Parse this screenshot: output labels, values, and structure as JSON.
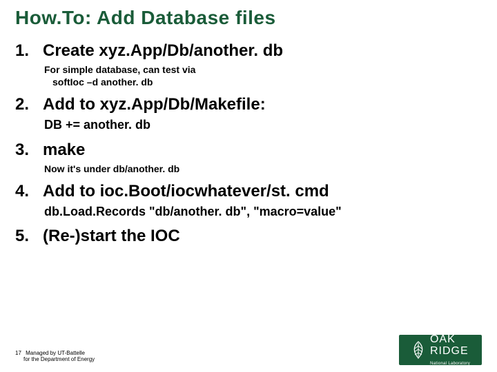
{
  "title": "How.To: Add Database files",
  "steps": [
    {
      "num": "1.",
      "head": "Create xyz.App/Db/another. db",
      "sub_line1": "For simple database, can test via",
      "sub_line2": "softIoc –d another. db"
    },
    {
      "num": "2.",
      "head": "Add to xyz.App/Db/Makefile:",
      "sub_line1": "DB += another. db",
      "sub_line2": ""
    },
    {
      "num": "3.",
      "head": "make",
      "sub_line1": "Now it's under db/another. db",
      "sub_line2": ""
    },
    {
      "num": "4.",
      "head": "Add to ioc.Boot/iocwhatever/st. cmd",
      "sub_line1": "db.Load.Records \"db/another. db\", \"macro=value\"",
      "sub_line2": ""
    },
    {
      "num": "5.",
      "head": "(Re-)start the IOC",
      "sub_line1": "",
      "sub_line2": ""
    }
  ],
  "footer": {
    "pagenum": "17",
    "line1": "Managed by UT-Battelle",
    "line2": "for the Department of Energy"
  },
  "logo": {
    "line1": "OAK",
    "line2": "RIDGE",
    "sub": "National Laboratory"
  },
  "colors": {
    "accent": "#1a5c39"
  }
}
